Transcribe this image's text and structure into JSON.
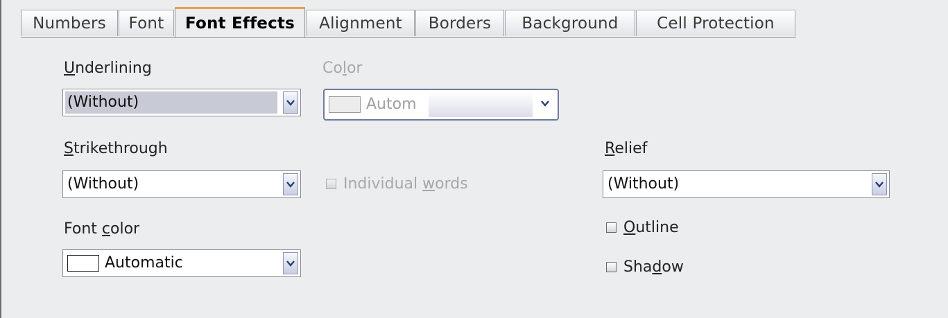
{
  "tabs": [
    {
      "label": "Numbers",
      "active": false
    },
    {
      "label": "Font",
      "active": false
    },
    {
      "label": "Font Effects",
      "active": true
    },
    {
      "label": "Alignment",
      "active": false
    },
    {
      "label": "Borders",
      "active": false
    },
    {
      "label": "Background",
      "active": false
    },
    {
      "label": "Cell Protection",
      "active": false
    }
  ],
  "underlining": {
    "label_mnemonic": "U",
    "label_rest": "nderlining",
    "value": "(Without)"
  },
  "color": {
    "label_pre": "Co",
    "label_mnemonic": "l",
    "label_rest": "or",
    "value": "Autom",
    "disabled": true
  },
  "strikethrough": {
    "label_mnemonic": "S",
    "label_rest": "trikethrough",
    "value": "(Without)"
  },
  "individual_words": {
    "label_pre": "Individual ",
    "label_mnemonic": "w",
    "label_rest": "ords",
    "checked": false,
    "disabled": true
  },
  "relief": {
    "label_mnemonic": "R",
    "label_rest": "elief",
    "value": "(Without)"
  },
  "font_color": {
    "label_pre": "Font ",
    "label_mnemonic": "c",
    "label_rest": "olor",
    "value": "Automatic",
    "swatch_color": "#ffffff"
  },
  "outline": {
    "label_mnemonic": "O",
    "label_rest": "utline",
    "checked": false
  },
  "shadow": {
    "label_pre": "Sha",
    "label_mnemonic": "d",
    "label_rest": "ow",
    "checked": false
  },
  "colors": {
    "active_tab_accent": "#e8a04a",
    "dialog_background": "#ecedef",
    "selection_highlight": "#c8cad6"
  }
}
